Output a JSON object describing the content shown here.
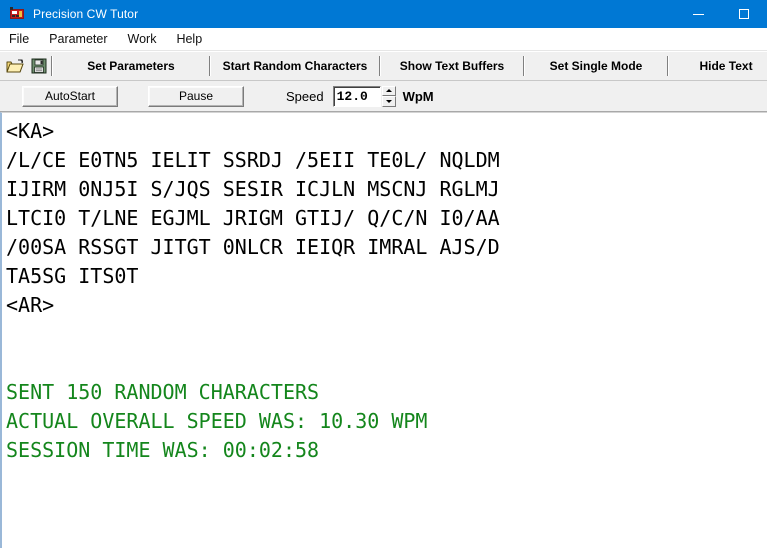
{
  "window": {
    "title": "Precision CW Tutor",
    "icon": "app-icon",
    "controls": {
      "minimize": "minimize-icon",
      "maximize": "maximize-icon"
    },
    "titlebar_color": "#0078d4"
  },
  "menubar": {
    "items": [
      {
        "label": "File"
      },
      {
        "label": "Parameter"
      },
      {
        "label": "Work"
      },
      {
        "label": "Help"
      }
    ]
  },
  "toolbar": {
    "icons": [
      {
        "name": "open-folder-icon",
        "title": "Open"
      },
      {
        "name": "save-floppy-icon",
        "title": "Save"
      }
    ],
    "buttons": [
      {
        "label": "Set Parameters"
      },
      {
        "label": "Start Random Characters"
      },
      {
        "label": "Show Text Buffers"
      },
      {
        "label": "Set Single Mode"
      },
      {
        "label": "Hide Text"
      }
    ]
  },
  "controlbar": {
    "autostart_label": "AutoStart",
    "pause_label": "Pause",
    "speed_label": "Speed",
    "speed_value": "12.0",
    "speed_unit": "WpM"
  },
  "output": {
    "text_color_normal": "#000000",
    "text_color_status": "#14861c",
    "lines": [
      {
        "text": "<KA>",
        "style": "black"
      },
      {
        "text": "/L/CE E0TN5 IELIT SSRDJ /5EII TE0L/ NQLDM",
        "style": "black"
      },
      {
        "text": "IJIRM 0NJ5I S/JQS SESIR ICJLN MSCNJ RGLMJ",
        "style": "black"
      },
      {
        "text": "LTCI0 T/LNE EGJML JRIGM GTIJ/ Q/C/N I0/AA",
        "style": "black"
      },
      {
        "text": "/00SA RSSGT JITGT 0NLCR IEIQR IMRAL AJS/D",
        "style": "black"
      },
      {
        "text": "TA5SG ITS0T",
        "style": "black"
      },
      {
        "text": "<AR>",
        "style": "black"
      },
      {
        "text": "",
        "style": "blank"
      },
      {
        "text": "",
        "style": "blank"
      },
      {
        "text": "SENT 150 RANDOM CHARACTERS",
        "style": "green"
      },
      {
        "text": "ACTUAL OVERALL SPEED WAS: 10.30 WPM",
        "style": "green"
      },
      {
        "text": "SESSION TIME WAS: 00:02:58",
        "style": "green"
      }
    ]
  }
}
